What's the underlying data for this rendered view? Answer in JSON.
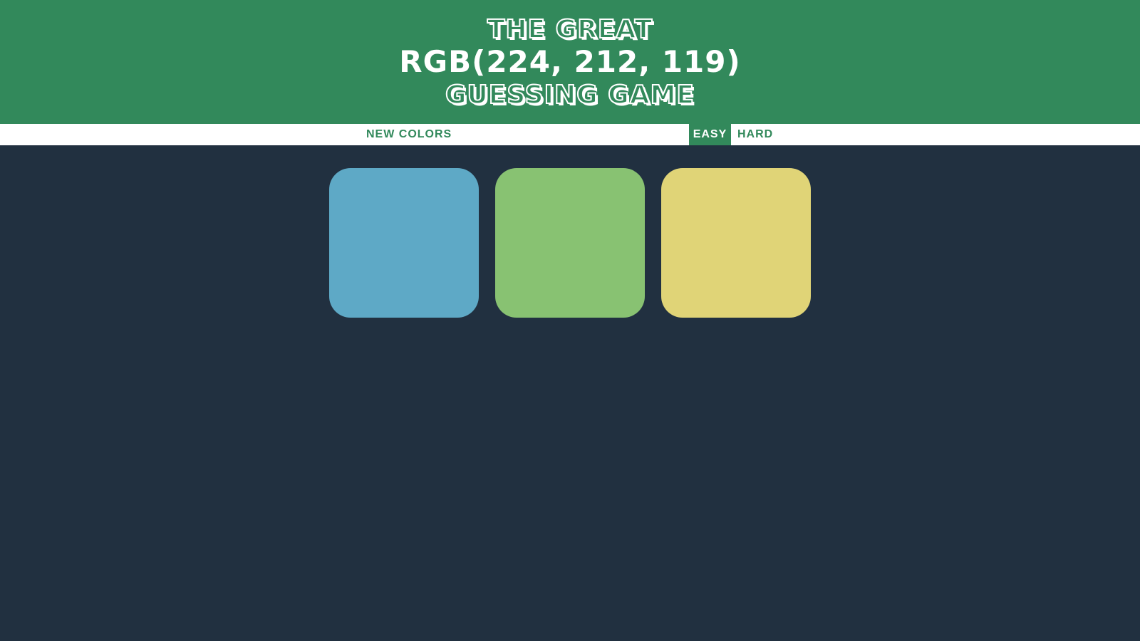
{
  "header": {
    "line1": "The Great",
    "target_color": "RGB(224, 212, 119)",
    "line3": "Guessing Game",
    "background": "#32895b"
  },
  "controls": {
    "new_colors_label": "NEW COLORS",
    "easy_label": "EASY",
    "hard_label": "HARD",
    "selected_mode": "EASY"
  },
  "board": {
    "background": "#213040",
    "squares": [
      {
        "color": "#5ea9c6"
      },
      {
        "color": "#88c272"
      },
      {
        "color": "#e0d477"
      }
    ]
  }
}
